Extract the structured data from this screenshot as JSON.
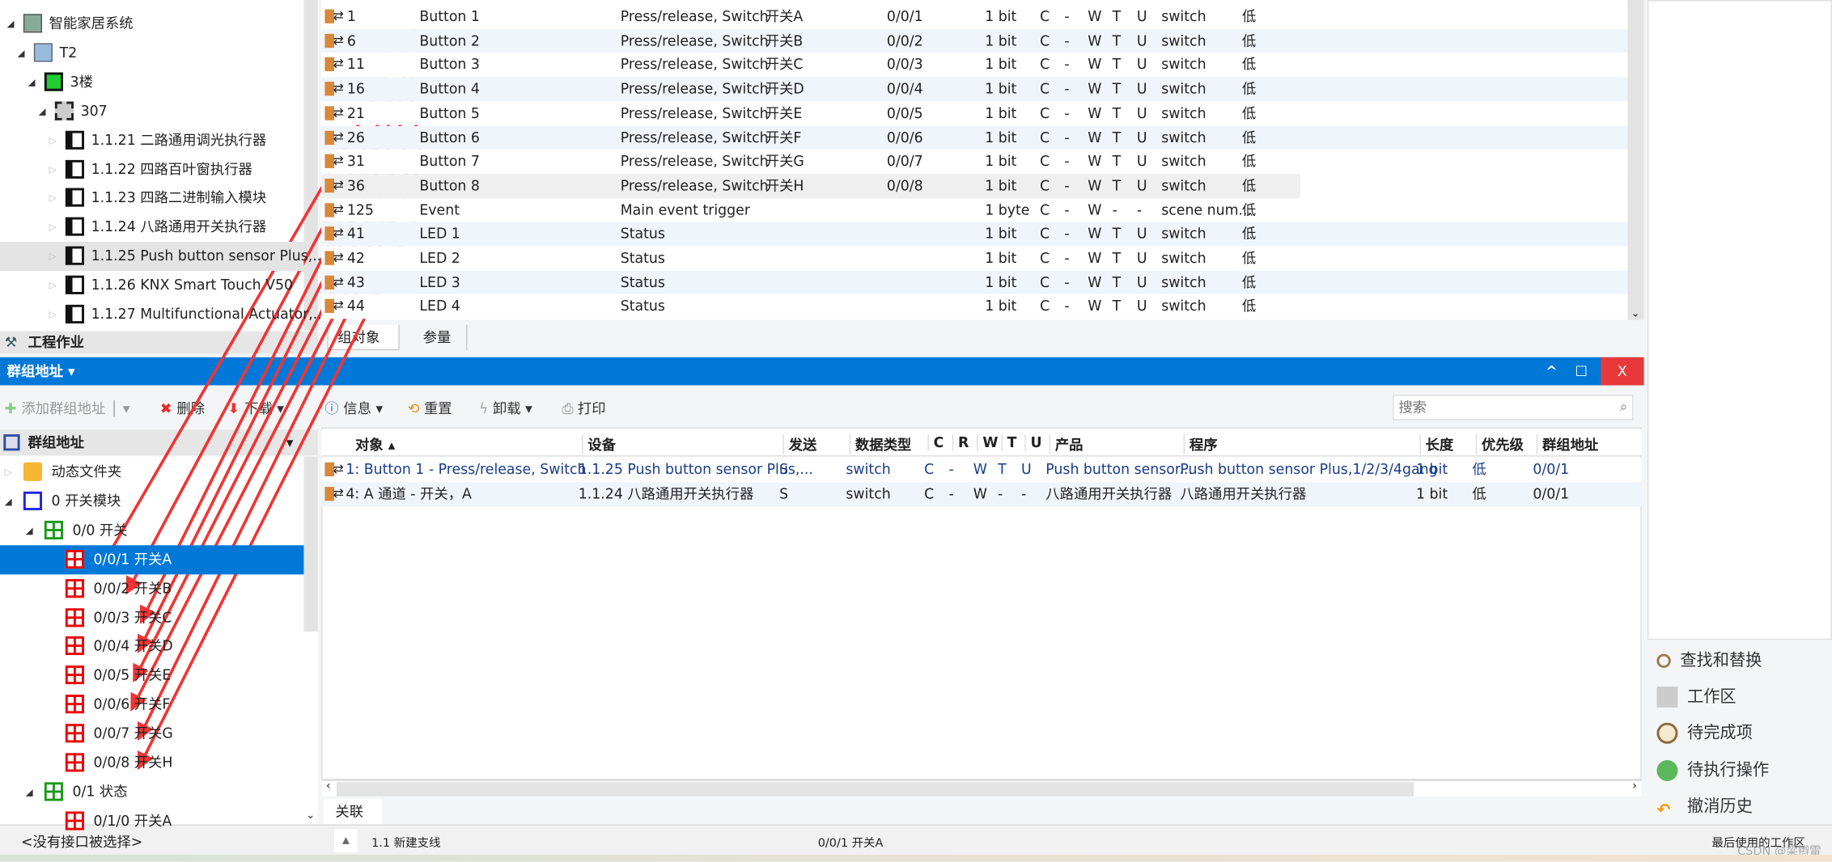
{
  "topology_tree": {
    "items": [
      {
        "label": "智能家居系统",
        "level": 0
      },
      {
        "label": "T2",
        "level": 1
      },
      {
        "label": "3楼",
        "level": 2
      },
      {
        "label": "307",
        "level": 3
      },
      {
        "label": "1.1.21 二路通用调光执行器",
        "level": 4
      },
      {
        "label": "1.1.22 四路百叶窗执行器",
        "level": 4
      },
      {
        "label": "1.1.23 四路二进制输入模块",
        "level": 4
      },
      {
        "label": "1.1.24 八路通用开关执行器",
        "level": 4
      },
      {
        "label": "1.1.25 Push button sensor Plus,...",
        "level": 4,
        "highlighted": true
      },
      {
        "label": "1.1.26 KNX Smart Touch V50",
        "level": 4
      },
      {
        "label": "1.1.27 Multifunctional Actuator,...",
        "level": 4
      }
    ],
    "section_label": "工程作业"
  },
  "objects_table": {
    "rows": [
      [
        "1",
        "Button 1",
        "Press/release, Switch",
        "开关A",
        "0/0/1",
        "1 bit",
        "C",
        "-",
        "W",
        "T",
        "U",
        "switch",
        "低"
      ],
      [
        "6",
        "Button 2",
        "Press/release, Switch",
        "开关B",
        "0/0/2",
        "1 bit",
        "C",
        "-",
        "W",
        "T",
        "U",
        "switch",
        "低"
      ],
      [
        "11",
        "Button 3",
        "Press/release, Switch",
        "开关C",
        "0/0/3",
        "1 bit",
        "C",
        "-",
        "W",
        "T",
        "U",
        "switch",
        "低"
      ],
      [
        "16",
        "Button 4",
        "Press/release, Switch",
        "开关D",
        "0/0/4",
        "1 bit",
        "C",
        "-",
        "W",
        "T",
        "U",
        "switch",
        "低"
      ],
      [
        "21",
        "Button 5",
        "Press/release, Switch",
        "开关E",
        "0/0/5",
        "1 bit",
        "C",
        "-",
        "W",
        "T",
        "U",
        "switch",
        "低"
      ],
      [
        "26",
        "Button 6",
        "Press/release, Switch",
        "开关F",
        "0/0/6",
        "1 bit",
        "C",
        "-",
        "W",
        "T",
        "U",
        "switch",
        "低"
      ],
      [
        "31",
        "Button 7",
        "Press/release, Switch",
        "开关G",
        "0/0/7",
        "1 bit",
        "C",
        "-",
        "W",
        "T",
        "U",
        "switch",
        "低"
      ],
      [
        "36",
        "Button 8",
        "Press/release, Switch",
        "开关H",
        "0/0/8",
        "1 bit",
        "C",
        "-",
        "W",
        "T",
        "U",
        "switch",
        "低"
      ],
      [
        "125",
        "Event",
        "Main event trigger",
        "",
        "",
        "1 byte",
        "C",
        "-",
        "W",
        "-",
        "-",
        "scene num...",
        "低"
      ],
      [
        "41",
        "LED 1",
        "Status",
        "",
        "",
        "1 bit",
        "C",
        "-",
        "W",
        "T",
        "U",
        "switch",
        "低"
      ],
      [
        "42",
        "LED 2",
        "Status",
        "",
        "",
        "1 bit",
        "C",
        "-",
        "W",
        "T",
        "U",
        "switch",
        "低"
      ],
      [
        "43",
        "LED 3",
        "Status",
        "",
        "",
        "1 bit",
        "C",
        "-",
        "W",
        "T",
        "U",
        "switch",
        "低"
      ],
      [
        "44",
        "LED 4",
        "Status",
        "",
        "",
        "1 bit",
        "C",
        "-",
        "W",
        "T",
        "U",
        "switch",
        "低"
      ]
    ],
    "tabs": [
      "组对象",
      "参量"
    ]
  },
  "group_panel": {
    "title": "群组地址 ▾",
    "window_buttons": [
      "^",
      "☐",
      "X"
    ],
    "toolbar": {
      "add": "添加群组地址",
      "delete": "删除",
      "download": "下载",
      "info": "信息",
      "reset": "重置",
      "unload": "卸载",
      "print": "打印",
      "search_placeholder": "搜索"
    },
    "tree_header": "群组地址",
    "tree": [
      {
        "label": "动态文件夹",
        "type": "folder",
        "level": 0
      },
      {
        "label": "0 开关模块",
        "type": "main",
        "level": 0
      },
      {
        "label": "0/0 开关",
        "type": "middle",
        "level": 1
      },
      {
        "label": "0/0/1 开关A",
        "type": "ga",
        "level": 2,
        "selected": true
      },
      {
        "label": "0/0/2 开关B",
        "type": "ga",
        "level": 2
      },
      {
        "label": "0/0/3 开关C",
        "type": "ga",
        "level": 2
      },
      {
        "label": "0/0/4 开关D",
        "type": "ga",
        "level": 2
      },
      {
        "label": "0/0/5 开关E",
        "type": "ga",
        "level": 2
      },
      {
        "label": "0/0/6 开关F",
        "type": "ga",
        "level": 2
      },
      {
        "label": "0/0/7 开关G",
        "type": "ga",
        "level": 2
      },
      {
        "label": "0/0/8 开关H",
        "type": "ga",
        "level": 2
      },
      {
        "label": "0/1 状态",
        "type": "middle",
        "level": 1
      },
      {
        "label": "0/1/0 开关A",
        "type": "ga",
        "level": 2
      }
    ],
    "links_table": {
      "headers": [
        "对象 ▴",
        "设备",
        "发送",
        "数据类型",
        "C",
        "R",
        "W",
        "T",
        "U",
        "产品",
        "程序",
        "长度",
        "优先级",
        "群组地址"
      ],
      "rows": [
        [
          "1: Button 1 - Press/release, Switch",
          "1.1.25 Push button sensor Plus,...",
          "S",
          "switch",
          "C",
          "-",
          "W",
          "T",
          "U",
          "Push button sensor...",
          "Push button sensor Plus,1/2/3/4gang",
          "1 bit",
          "低",
          "0/0/1"
        ],
        [
          "4: A 通道 - 开关，A",
          "1.1.24 八路通用开关执行器",
          "S",
          "switch",
          "C",
          "-",
          "W",
          "-",
          "-",
          "八路通用开关执行器",
          "八路通用开关执行器",
          "1 bit",
          "低",
          "0/0/1"
        ]
      ],
      "tab": "关联"
    }
  },
  "side_panel": {
    "items": [
      "查找和替换",
      "工作区",
      "待完成项",
      "待执行操作",
      "撤消历史"
    ]
  },
  "status_bar": {
    "interface": "<没有接口被选择>",
    "line": "1.1 新建支线",
    "group": "0/0/1 开关A",
    "workspace": "最后使用的工作区"
  },
  "watermark": "CSDN @梁辫雷",
  "colors": {
    "accent": "#0078d7",
    "arrow": "#f03434",
    "close": "#e81123"
  }
}
